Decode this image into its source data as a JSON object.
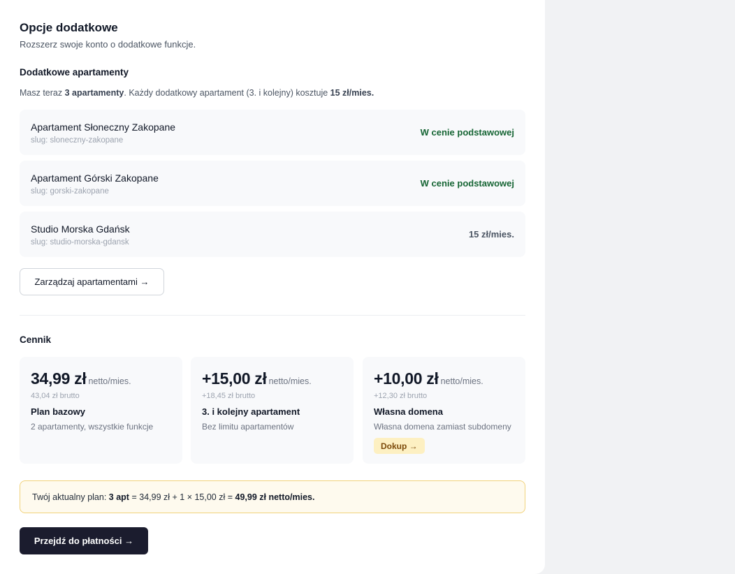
{
  "header": {
    "title": "Opcje dodatkowe",
    "subtitle": "Rozszerz swoje konto o dodatkowe funkcje."
  },
  "apartments_section": {
    "title": "Dodatkowe apartamenty",
    "desc_prefix": "Masz teraz ",
    "desc_count": "3 apartamenty",
    "desc_middle": ". Każdy dodatkowy apartament (3. i kolejny) kosztuje ",
    "desc_price": "15 zł/mies.",
    "items": [
      {
        "name": "Apartament Słoneczny Zakopane",
        "slug": "slug: sloneczny-zakopane",
        "price": "W cenie podstawowej"
      },
      {
        "name": "Apartament Górski Zakopane",
        "slug": "slug: gorski-zakopane",
        "price": "W cenie podstawowej"
      },
      {
        "name": "Studio Morska Gdańsk",
        "slug": "slug: studio-morska-gdansk",
        "price": "15 zł/mies."
      }
    ],
    "manage_button": "Zarządzaj apartamentami →"
  },
  "pricing_section": {
    "title": "Cennik",
    "cards": [
      {
        "amount": "34,99 zł",
        "unit": "netto/mies.",
        "brutto": "43,04 zł brutto",
        "name": "Plan bazowy",
        "desc": "2 apartamenty, wszystkie funkcje"
      },
      {
        "amount": "+15,00 zł",
        "unit": "netto/mies.",
        "brutto": "+18,45 zł brutto",
        "name": "3. i kolejny apartament",
        "desc": "Bez limitu apartamentów"
      },
      {
        "amount": "+10,00 zł",
        "unit": "netto/mies.",
        "brutto": "+12,30 zł brutto",
        "name": "Własna domena",
        "desc": "Własna domena zamiast subdomeny",
        "button": "Dokup →"
      }
    ]
  },
  "summary": {
    "prefix": "Twój aktualny plan: ",
    "apt": "3 apt",
    "formula": " = 34,99 zł + 1 × 15,00 zł = ",
    "total": "49,99 zł netto/mies."
  },
  "checkout_button": "Przejdź do płatności →",
  "colors": {
    "included_green": "#166534",
    "dark_button": "#1b1c2e",
    "summary_border": "#f1d27a",
    "dokup_bg": "#fdf0c2"
  }
}
